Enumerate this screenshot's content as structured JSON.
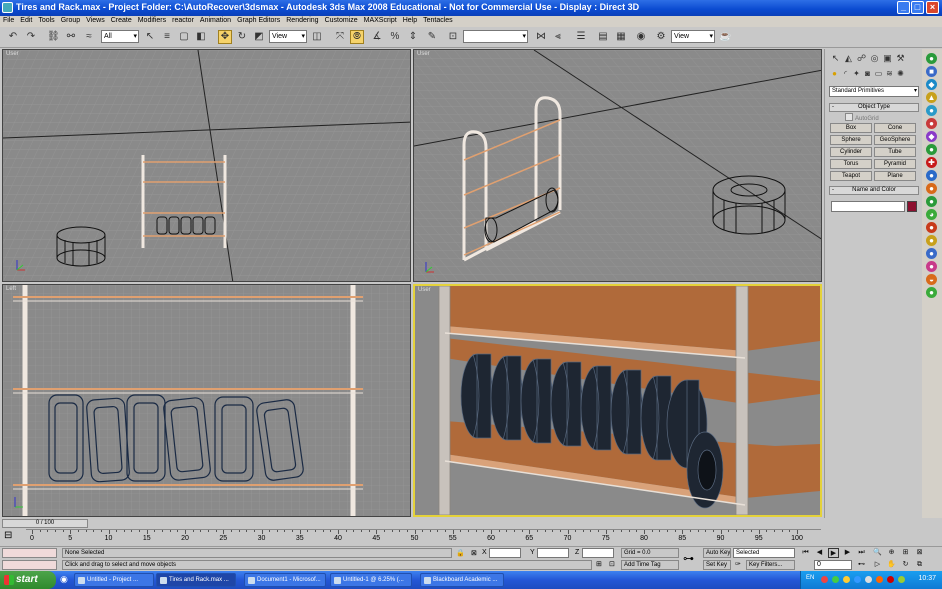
{
  "window": {
    "title": "Tires and Rack.max    - Project Folder: C:\\AutoRecover\\3dsmax    - Autodesk 3ds Max 2008   Educational  - Not for Commercial Use      - Display : Direct 3D"
  },
  "menu": [
    "File",
    "Edit",
    "Tools",
    "Group",
    "Views",
    "Create",
    "Modifiers",
    "reactor",
    "Animation",
    "Graph Editors",
    "Rendering",
    "Customize",
    "MAXScript",
    "Help",
    "Tentacles"
  ],
  "toolbar": {
    "selection_filter": "All",
    "ref_coord": "View",
    "named_sel": "",
    "render_view": "View"
  },
  "viewports": {
    "top_left": "User",
    "top_right": "User",
    "bottom_left": "Left",
    "bottom_right": "User"
  },
  "command_panel": {
    "category": "Standard Primitives",
    "object_type_title": "Object Type",
    "autogrid": "AutoGrid",
    "buttons": [
      "Box",
      "Cone",
      "Sphere",
      "GeoSphere",
      "Cylinder",
      "Tube",
      "Torus",
      "Pyramid",
      "Teapot",
      "Plane"
    ],
    "name_color_title": "Name and Color",
    "object_name": "",
    "color": "#8c1030"
  },
  "timeline": {
    "slider": "0 / 100",
    "ticks": [
      0,
      5,
      10,
      15,
      20,
      25,
      30,
      35,
      40,
      45,
      50,
      55,
      60,
      65,
      70,
      75,
      80,
      85,
      90,
      95,
      100
    ]
  },
  "status": {
    "selection": "None Selected",
    "prompt": "Click and drag to select and move objects",
    "x_label": "X",
    "y_label": "Y",
    "z_label": "Z",
    "x": "",
    "y": "",
    "z": "",
    "grid": "Grid = 0.0",
    "add_time_tag": "Add Time Tag",
    "auto_key": "Auto Key",
    "set_key": "Set Key",
    "key_mode": "Selected",
    "key_filters": "Key Filters...",
    "frame": "0"
  },
  "taskbar": {
    "start": "start",
    "tasks": [
      "Untitled - Project ...",
      "Tires and Rack.max ...",
      "Document1 - Microsof...",
      "Untitled-1 @ 6.25% (...",
      "Blackboard Academic ..."
    ],
    "lang": "EN",
    "clock": "10:37"
  }
}
